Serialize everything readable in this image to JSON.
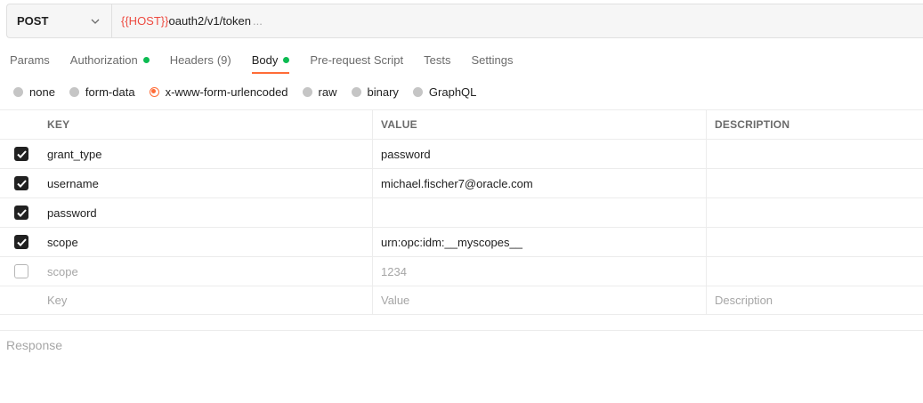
{
  "request": {
    "method": "POST",
    "url_variable": "{{HOST}}",
    "url_path": "oauth2/v1/token",
    "url_ellipsis": "..."
  },
  "tabs": [
    {
      "label": "Params"
    },
    {
      "label": "Authorization"
    },
    {
      "label": "Headers",
      "count": "(9)"
    },
    {
      "label": "Body"
    },
    {
      "label": "Pre-request Script"
    },
    {
      "label": "Tests"
    },
    {
      "label": "Settings"
    }
  ],
  "body_types": [
    "none",
    "form-data",
    "x-www-form-urlencoded",
    "raw",
    "binary",
    "GraphQL"
  ],
  "body_type_selected": "x-www-form-urlencoded",
  "table": {
    "headers": {
      "key": "KEY",
      "value": "VALUE",
      "description": "DESCRIPTION"
    },
    "rows": [
      {
        "checked": true,
        "key": "grant_type",
        "value": "password",
        "description": ""
      },
      {
        "checked": true,
        "key": "username",
        "value": "michael.fischer7@oracle.com",
        "description": ""
      },
      {
        "checked": true,
        "key": "password",
        "value": "",
        "description": ""
      },
      {
        "checked": true,
        "key": "scope",
        "value": "urn:opc:idm:__myscopes__",
        "description": ""
      },
      {
        "checked": false,
        "key": "scope",
        "value": "1234",
        "description": ""
      }
    ],
    "placeholder": {
      "key": "Key",
      "value": "Value",
      "description": "Description"
    }
  },
  "response_label": "Response",
  "colors": {
    "accent": "#ff6c37",
    "status_dot": "#0cbb52",
    "variable": "#eb2013"
  }
}
